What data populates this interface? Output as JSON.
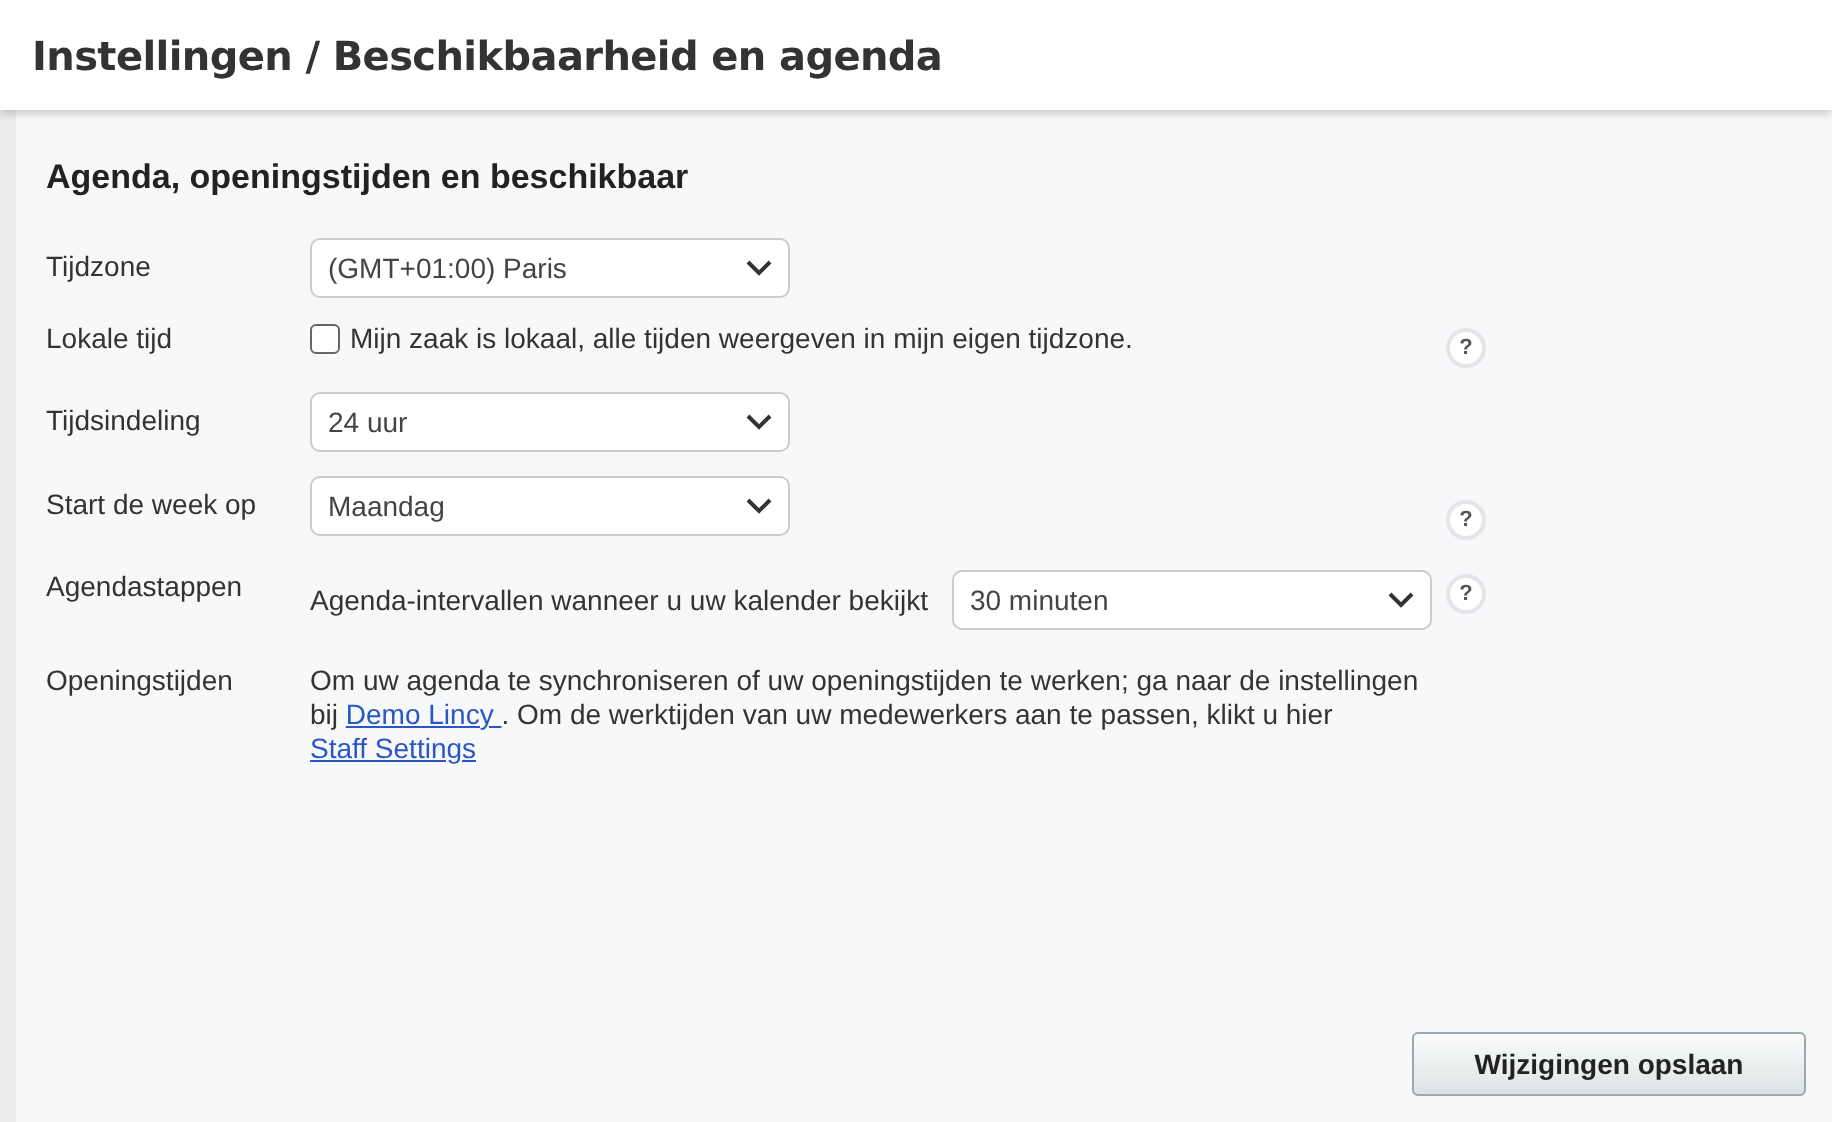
{
  "header": {
    "title": "Instellingen / Beschikbaarheid en agenda"
  },
  "section": {
    "title": "Agenda, openingstijden en beschikbaar"
  },
  "rows": [
    {
      "kind": "select",
      "label": "Tijdzone",
      "value": "(GMT+01:00) Paris"
    },
    {
      "kind": "checkbox",
      "label": "Lokale tijd",
      "text": "Mijn zaak is lokaal, alle tijden weergeven in mijn eigen tijdzone.",
      "checked": false,
      "help": "?"
    },
    {
      "kind": "select",
      "label": "Tijdsindeling",
      "value": "24 uur"
    },
    {
      "kind": "select",
      "label": "Start de week op",
      "value": "Maandag",
      "help": "?"
    },
    {
      "kind": "inline_select",
      "label": "Agendastappen",
      "text": "Agenda-intervallen wanneer u uw kalender bekijkt",
      "value": "30 minuten",
      "help": "?"
    },
    {
      "kind": "paragraph",
      "label": "Openingstijden",
      "parts": [
        {
          "kind": "text",
          "text": "Om uw agenda te synchroniseren of uw openingstijden te werken; ga naar de instellingen bij "
        },
        {
          "kind": "link",
          "text": "Demo Lincy "
        },
        {
          "kind": "text",
          "text": ". Om de werktijden van uw medewerkers aan te passen, klikt u hier "
        },
        {
          "kind": "link",
          "text": "Staff Settings"
        }
      ]
    }
  ],
  "save_button": "Wijzigingen opslaan"
}
